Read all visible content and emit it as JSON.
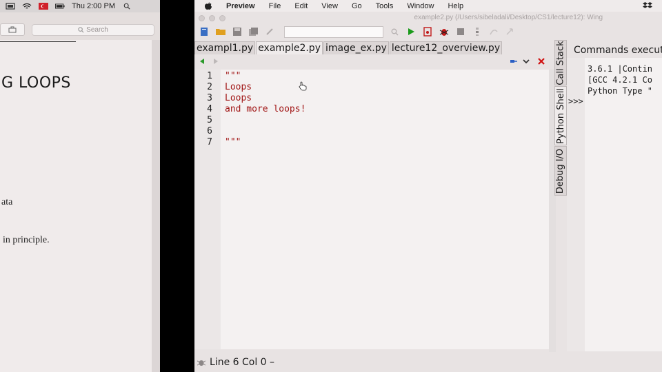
{
  "left_window": {
    "menubar": {
      "clock": "Thu 2:00 PM"
    },
    "search_placeholder": "Search",
    "document": {
      "heading": "G LOOPS",
      "line1": "ata",
      "line2": "in principle."
    }
  },
  "app_menubar": {
    "items": [
      "Preview",
      "File",
      "Edit",
      "View",
      "Go",
      "Tools",
      "Window",
      "Help"
    ]
  },
  "window_title": "example2.py (/Users/sibeladali/Desktop/CS1/lecture12): Wing",
  "tabs": [
    {
      "label": "exampl1.py",
      "active": false
    },
    {
      "label": "example2.py",
      "active": true
    },
    {
      "label": "image_ex.py",
      "active": false
    },
    {
      "label": "lecture12_overview.py",
      "active": false
    }
  ],
  "editor": {
    "lines": [
      {
        "num": "1",
        "text": "\"\"\""
      },
      {
        "num": "2",
        "text": "Loops"
      },
      {
        "num": "3",
        "text": "Loops"
      },
      {
        "num": "4",
        "text": "and more loops!"
      },
      {
        "num": "5",
        "text": ""
      },
      {
        "num": "6",
        "text": ""
      },
      {
        "num": "7",
        "text": "\"\"\""
      }
    ]
  },
  "side_tabs": [
    "Call Stack",
    "Python Shell",
    "Debug I/O"
  ],
  "shell": {
    "header": "Commands execute",
    "prompt": ">>>",
    "output": [
      "3.6.1 |Contin",
      "[GCC 4.2.1 Co",
      "Python Type \""
    ]
  },
  "status": {
    "position": "Line 6 Col 0 –"
  },
  "colors": {
    "code": "#a11616",
    "run_icon": "#1a9a1a",
    "close_x": "#d01010",
    "nav_arrow": "#2a9a2a"
  }
}
